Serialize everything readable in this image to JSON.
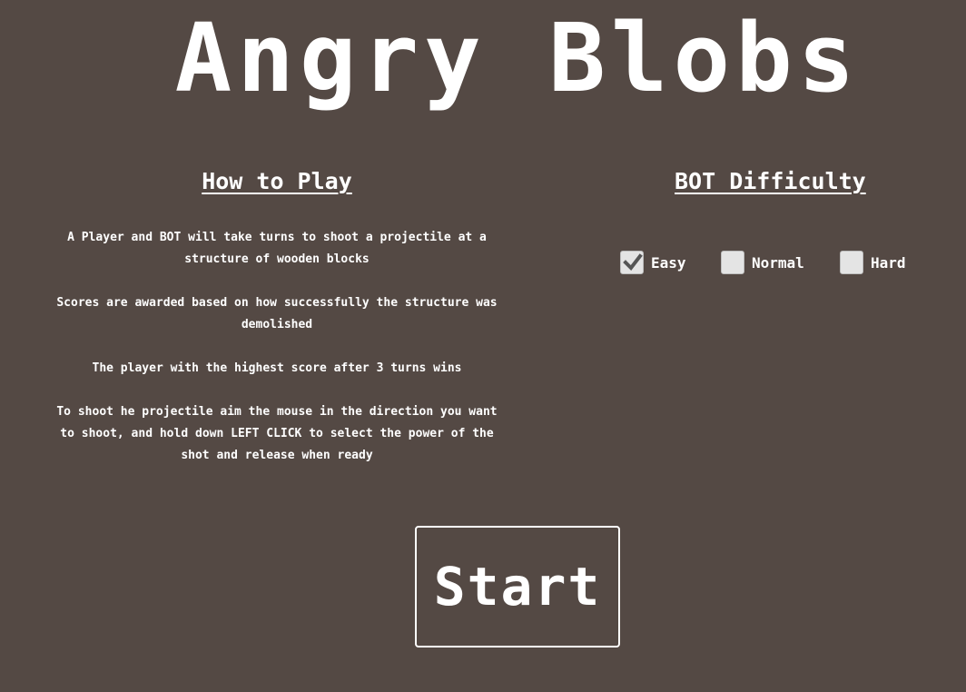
{
  "game": {
    "title": "Angry Blobs"
  },
  "how_to_play": {
    "heading": "How to Play",
    "paragraphs": [
      "A Player and BOT will take turns to shoot a projectile at a structure of wooden blocks",
      "Scores are awarded based on how successfully the structure was demolished",
      "The player with the highest score after 3 turns wins",
      "To shoot he projectile aim the mouse in the direction you want to shoot, and hold down LEFT CLICK to select the power of the shot and release when ready"
    ]
  },
  "difficulty": {
    "heading": "BOT Difficulty",
    "options": [
      {
        "label": "Easy",
        "checked": true
      },
      {
        "label": "Normal",
        "checked": false
      },
      {
        "label": "Hard",
        "checked": false
      }
    ],
    "checkbox_color": "#e4e4e4",
    "check_color": "#555555"
  },
  "start_button": {
    "label": "Start"
  },
  "colors": {
    "background": "#544944",
    "text": "#ffffff"
  }
}
